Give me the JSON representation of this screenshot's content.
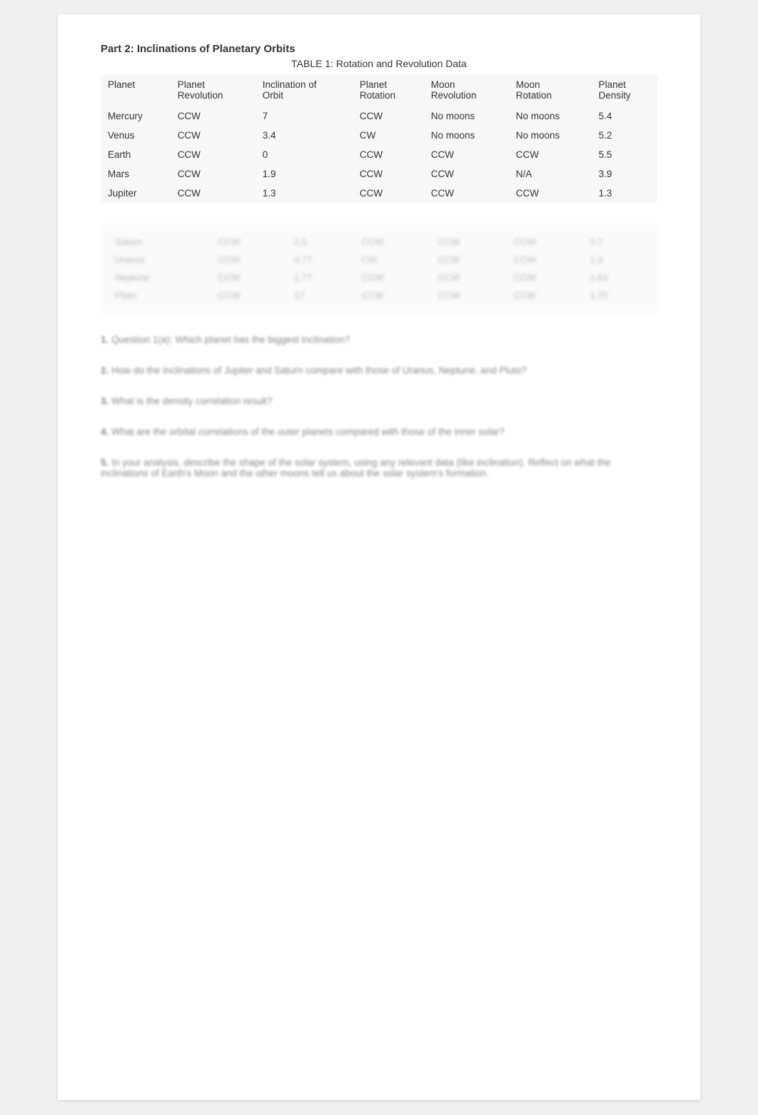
{
  "part2": {
    "title": "Part 2: Inclinations of Planetary Orbits",
    "tableTitle": "TABLE 1: Rotation and Revolution Data",
    "columns": [
      "Planet",
      "Planet Revolution",
      "Inclination of Orbit",
      "Planet Rotation",
      "Moon Revolution",
      "Moon Rotation",
      "Planet Density"
    ],
    "rows": [
      [
        "Mercury",
        "CCW",
        "7",
        "CCW",
        "No moons",
        "No moons",
        "5.4"
      ],
      [
        "Venus",
        "CCW",
        "3.4",
        "CW",
        "No moons",
        "No moons",
        "5.2"
      ],
      [
        "Earth",
        "CCW",
        "0",
        "CCW",
        "CCW",
        "CCW",
        "5.5"
      ],
      [
        "Mars",
        "CCW",
        "1.9",
        "CCW",
        "CCW",
        "N/A",
        "3.9"
      ],
      [
        "Jupiter",
        "CCW",
        "1.3",
        "CCW",
        "CCW",
        "CCW",
        "1.3"
      ]
    ],
    "blurredRows": [
      [
        "Saturn",
        "CCW",
        "2.5",
        "CCW",
        "CCW",
        "CCW",
        "0.7"
      ],
      [
        "Uranus",
        "CCW",
        "0.77",
        "CW",
        "CCW",
        "CCW",
        "1.3"
      ],
      [
        "Neptune",
        "CCW",
        "1.77",
        "CCW",
        "CCW",
        "CCW",
        "1.64"
      ],
      [
        "Pluto",
        "CCW",
        "17",
        "CCW",
        "CCW",
        "CCW",
        "1.75"
      ]
    ]
  },
  "questions": [
    {
      "number": "1.",
      "text": "Question 1(a): Which planet has the biggest inclination?"
    },
    {
      "number": "2.",
      "text": "How do the inclinations of Jupiter and Saturn compare with those of Uranus, Neptune, and Pluto?"
    },
    {
      "number": "3.",
      "text": "What is the density correlation result?"
    },
    {
      "number": "4.",
      "text": "What are the orbital correlations of the outer planets compared with those of the inner solar?"
    },
    {
      "number": "5.",
      "text": "In your analysis, describe the shape of the solar system, using any relevant data (like inclination). Reflect on what the inclinations of Earth's Moon and the other moons tell us about the solar system's formation."
    }
  ]
}
